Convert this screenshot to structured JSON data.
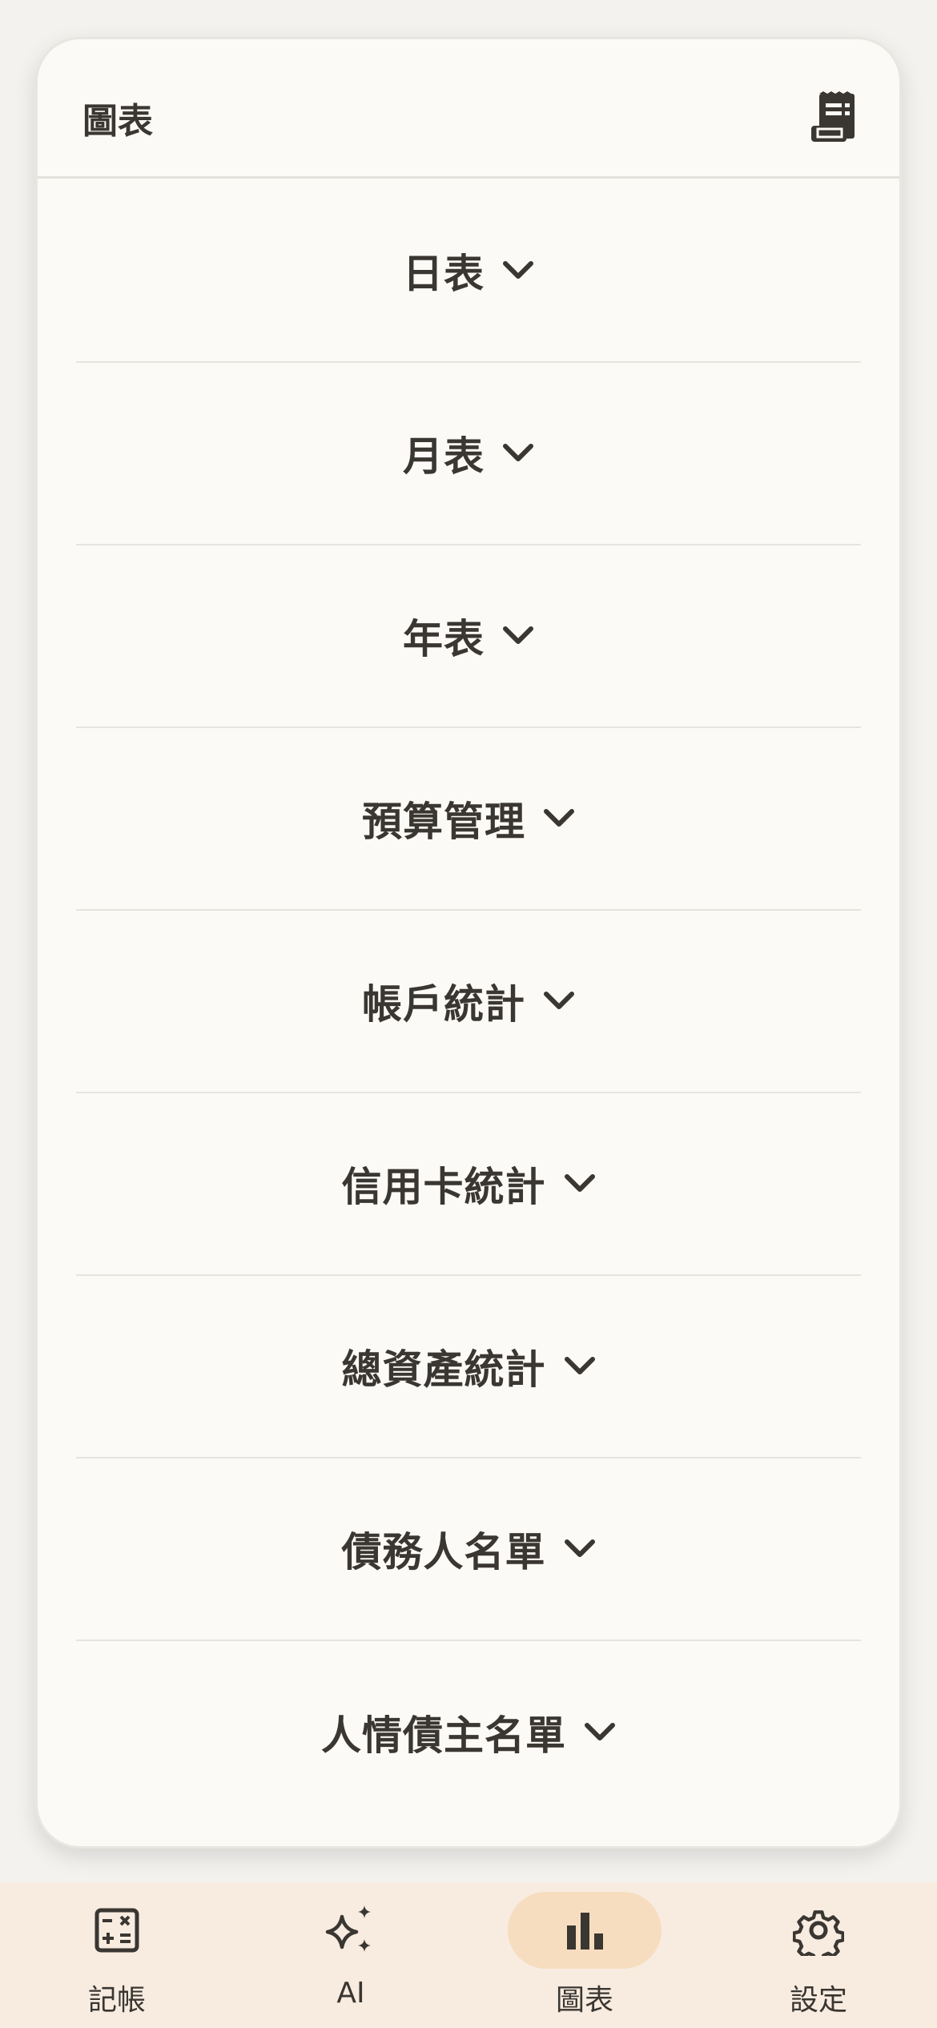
{
  "header": {
    "title": "圖表",
    "icon": "receipt-icon"
  },
  "sections": [
    {
      "label": "日表"
    },
    {
      "label": "月表"
    },
    {
      "label": "年表"
    },
    {
      "label": "預算管理"
    },
    {
      "label": "帳戶統計"
    },
    {
      "label": "信用卡統計"
    },
    {
      "label": "總資產統計"
    },
    {
      "label": "債務人名單"
    },
    {
      "label": "人情債主名單"
    }
  ],
  "tabs": [
    {
      "label": "記帳",
      "icon": "calculator-icon"
    },
    {
      "label": "AI",
      "icon": "sparkle-icon"
    },
    {
      "label": "圖表",
      "icon": "bar-chart-icon",
      "active": true
    },
    {
      "label": "設定",
      "icon": "gear-icon"
    }
  ],
  "colors": {
    "accent": "#f6ddbf",
    "tabbar": "#f8ece0",
    "text": "#3a3632"
  }
}
